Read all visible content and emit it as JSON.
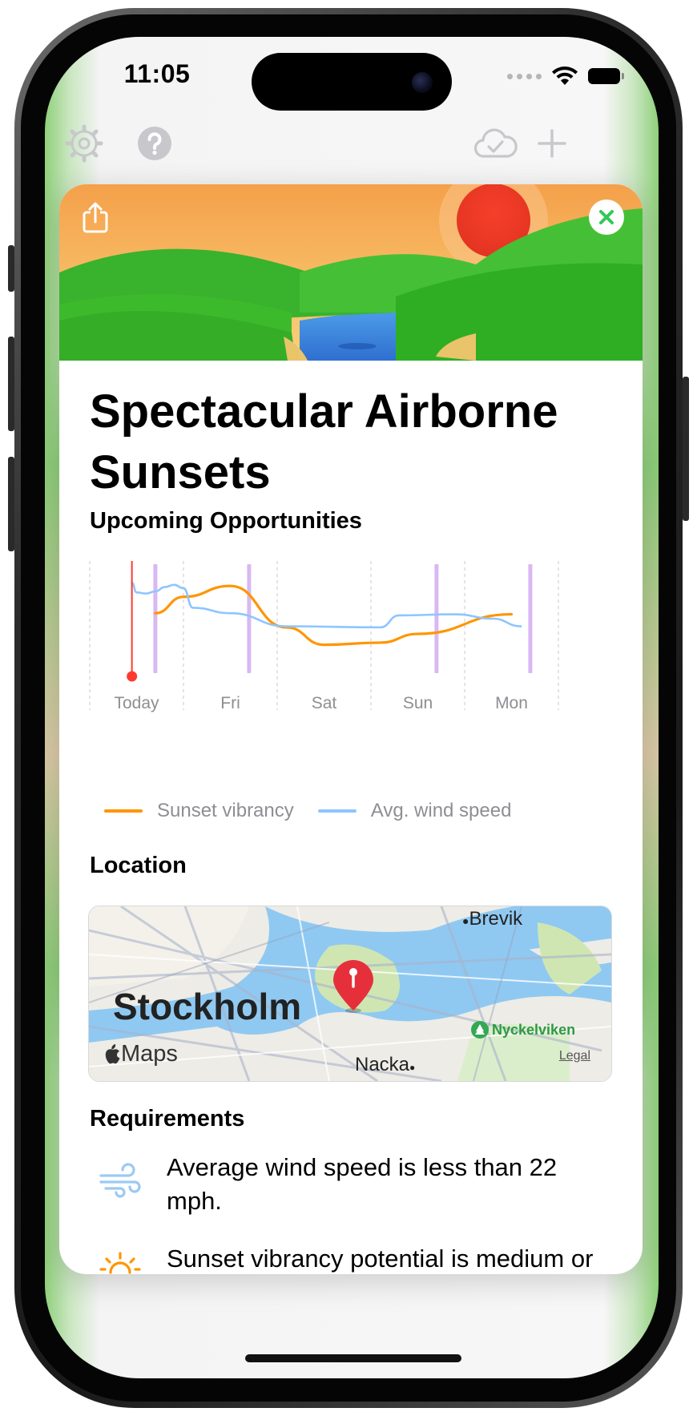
{
  "status_bar": {
    "time": "11:05"
  },
  "toolbar": {
    "left_icons": [
      "gear-icon",
      "help-icon"
    ],
    "right_icons": [
      "icloud-check-icon",
      "plus-icon"
    ]
  },
  "card": {
    "title": "Spectacular Airborne Sunsets",
    "hero_icons": [
      "share-icon",
      "close-icon"
    ],
    "sections": {
      "upcoming": "Upcoming Opportunities",
      "location": "Location",
      "requirements": "Requirements"
    }
  },
  "chart_data": {
    "type": "line",
    "categories": [
      "Today",
      "Fri",
      "Sat",
      "Sun",
      "Mon"
    ],
    "series": [
      {
        "name": "Sunset vibrancy",
        "color": "#ff9500",
        "x": [
          0.2,
          0.5,
          1.0,
          1.6,
          2.0,
          2.6,
          3.0,
          4.0
        ],
        "values": [
          0.55,
          0.7,
          0.8,
          0.42,
          0.26,
          0.28,
          0.36,
          0.54
        ]
      },
      {
        "name": "Avg. wind speed",
        "color": "#8ec5ff",
        "x": [
          -0.05,
          0.0,
          0.1,
          0.2,
          0.3,
          0.4,
          0.5,
          0.6,
          1.0,
          1.6,
          2.6,
          2.8,
          3.4,
          3.8,
          4.1
        ],
        "values": [
          0.83,
          0.74,
          0.73,
          0.75,
          0.79,
          0.81,
          0.78,
          0.6,
          0.55,
          0.43,
          0.42,
          0.53,
          0.54,
          0.5,
          0.43
        ]
      }
    ],
    "current_time_x": -0.05,
    "event_markers_x": [
      0.2,
      1.2,
      3.2,
      4.2
    ],
    "ylim": [
      0,
      1
    ],
    "legend": "bottom",
    "grid": "vertical-dashed"
  },
  "map": {
    "city": "Stockholm",
    "labels": {
      "brevik": "Brevik",
      "nyckelviken": "Nyckelviken",
      "nacka": "Nacka"
    },
    "attribution": "Maps",
    "legal": "Legal",
    "pin_icon": "map-pin-icon"
  },
  "requirements": [
    {
      "icon": "wind-icon",
      "text": "Average wind speed is less than 22 mph.",
      "color": "#9cc9f5"
    },
    {
      "icon": "sunset-icon",
      "text": "Sunset vibrancy potential is medium or better.",
      "color": "#ff9500"
    }
  ]
}
